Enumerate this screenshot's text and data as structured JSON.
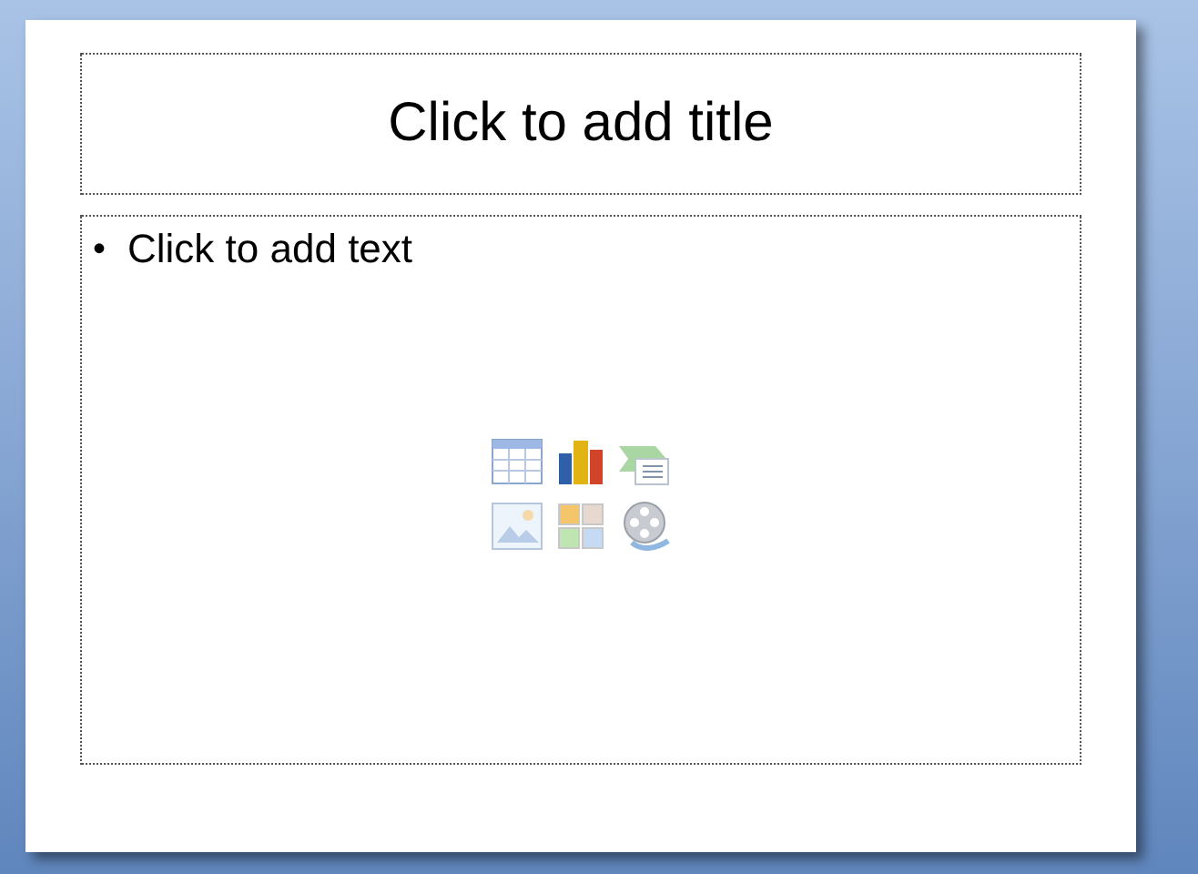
{
  "slide": {
    "title_placeholder": {
      "text": "Click to add title"
    },
    "body_placeholder": {
      "bullet": "•",
      "text": "Click to add text"
    }
  }
}
